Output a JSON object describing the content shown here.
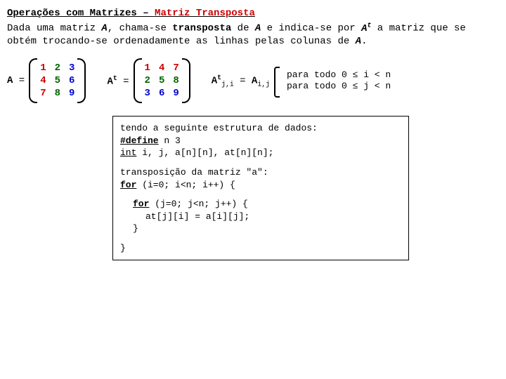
{
  "title": {
    "prefix": "Operações com Matrizes – ",
    "highlight": "Matriz Transposta"
  },
  "intro": {
    "t1": "Dada uma matriz ",
    "A": "A",
    "t2": ", chama-se ",
    "transp": "transposta",
    "t3": " de ",
    "t4": " e indica-se por ",
    "At_A": "A",
    "At_t": "t",
    "t5": " a matriz que se obtém trocando-se ordenadamente as linhas pelas colunas de ",
    "t6": "."
  },
  "matA": {
    "label_A": "A",
    "eq": " = ",
    "cells": [
      "1",
      "2",
      "3",
      "4",
      "5",
      "6",
      "7",
      "8",
      "9"
    ]
  },
  "matAt": {
    "label_A": "A",
    "label_t": "t",
    "eq": " = ",
    "cells": [
      "1",
      "4",
      "7",
      "2",
      "5",
      "8",
      "3",
      "6",
      "9"
    ]
  },
  "formula": {
    "A1": "A",
    "t1": "t",
    "sub1": "j,i",
    "eq": " = ",
    "A2": "A",
    "sub2": "i,j"
  },
  "cond": {
    "l1a": "para todo 0 ",
    "l1b": "≤",
    "l1c": " i < n",
    "l2a": "para todo 0 ",
    "l2b": "≤",
    "l2c": " j < n"
  },
  "code": {
    "l1": "tendo a seguinte estrutura de dados:",
    "def": "#define",
    "def_rest": " n 3",
    "int_kw": "int",
    "int_rest": " i, j, a[n][n], at[n][n];",
    "l4": "transposição da matriz \"a\":",
    "for1_kw": "for",
    "for1_rest": " (i=0; i<n; i++) {",
    "for2_kw": "for",
    "for2_rest": " (j=0; j<n; j++) {",
    "asg": "at[j][i] = a[i][j];",
    "cb": "}"
  }
}
